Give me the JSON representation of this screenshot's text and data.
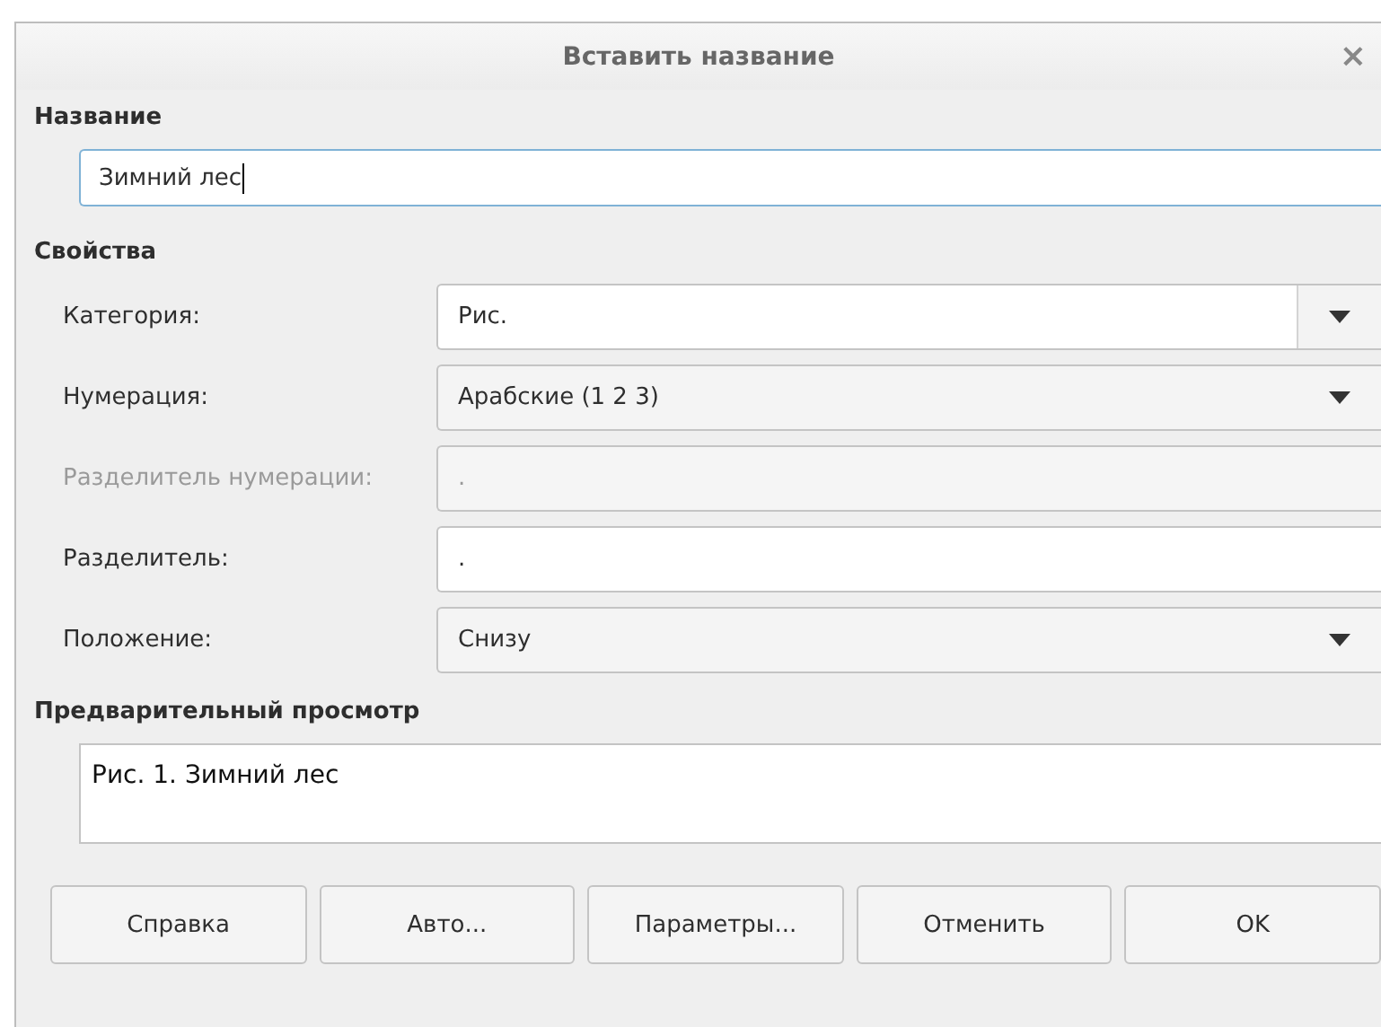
{
  "window": {
    "title": "Вставить название",
    "close": "×"
  },
  "caption": {
    "heading": "Название",
    "value": "Зимний лес"
  },
  "properties": {
    "heading": "Свойства",
    "rows": [
      {
        "kind": "combo-edit",
        "label": "Категория:",
        "value": "Рис.",
        "disabled": false
      },
      {
        "kind": "combo",
        "label": "Нумерация:",
        "value": "Арабские (1 2 3)",
        "disabled": false
      },
      {
        "kind": "edit",
        "label": "Разделитель нумерации:",
        "value": ".",
        "disabled": true
      },
      {
        "kind": "edit",
        "label": "Разделитель:",
        "value": ".",
        "disabled": false
      },
      {
        "kind": "combo",
        "label": "Положение:",
        "value": "Снизу",
        "disabled": false
      }
    ]
  },
  "preview": {
    "heading": "Предварительный просмотр",
    "text": "Рис. 1. Зимний лес"
  },
  "buttons": [
    "Справка",
    "Авто...",
    "Параметры...",
    "Отменить",
    "OK"
  ]
}
